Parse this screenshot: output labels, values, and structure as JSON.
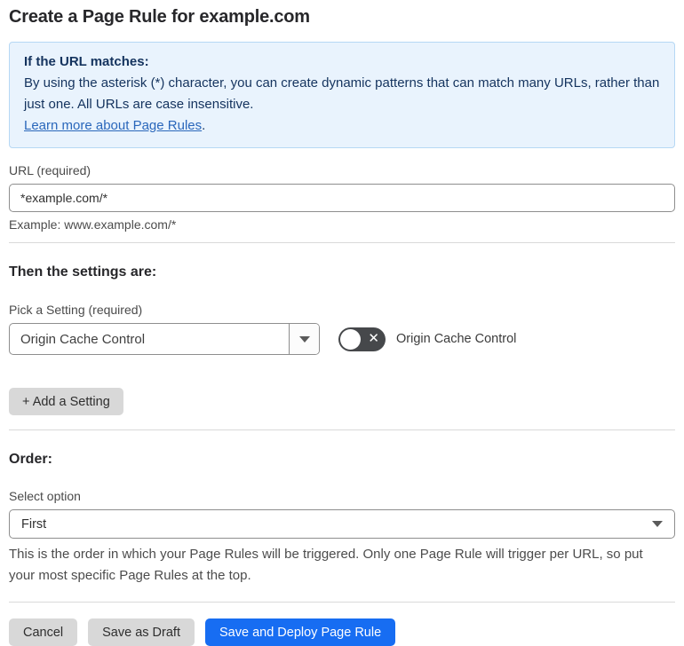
{
  "page": {
    "title": "Create a Page Rule for example.com"
  },
  "info_box": {
    "heading": "If the URL matches:",
    "body": "By using the asterisk (*) character, you can create dynamic patterns that can match many URLs, rather than just one. All URLs are case insensitive.",
    "link_label": "Learn more about Page Rules",
    "link_suffix": "."
  },
  "url_field": {
    "label": "URL (required)",
    "value": "*example.com/*",
    "help": "Example: www.example.com/*"
  },
  "settings_section": {
    "heading": "Then the settings are:",
    "picker_label": "Pick a Setting (required)",
    "selected_setting": "Origin Cache Control",
    "toggle_label": "Origin Cache Control",
    "toggle_state": "off",
    "toggle_x": "✕",
    "add_setting_label": "+ Add a Setting"
  },
  "order_section": {
    "heading": "Order:",
    "select_label": "Select option",
    "selected_option": "First",
    "help": "This is the order in which your Page Rules will be triggered. Only one Page Rule will trigger per URL, so put your most specific Page Rules at the top."
  },
  "footer": {
    "cancel_label": "Cancel",
    "save_draft_label": "Save as Draft",
    "save_deploy_label": "Save and Deploy Page Rule"
  },
  "colors": {
    "primary_blue": "#176df2",
    "info_background": "#e9f3fd",
    "info_border": "#b6d8f4",
    "info_text": "#14335e",
    "link_blue": "#2a67bb",
    "toggle_off_background": "#46484b",
    "gray_button": "#d8d8d8"
  }
}
